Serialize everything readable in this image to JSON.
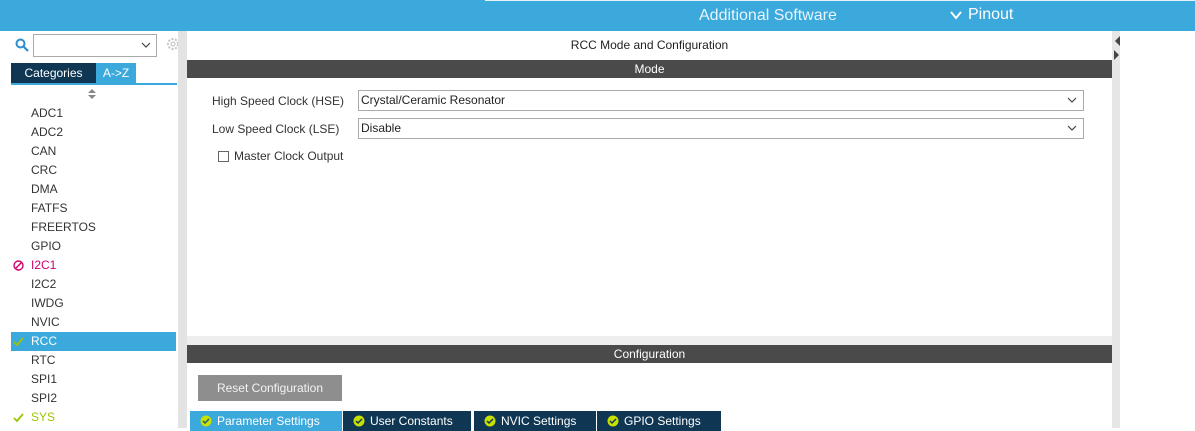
{
  "topbar": {
    "additional_software": "Additional Software",
    "pinout": "Pinout"
  },
  "sidebar": {
    "search_value": "",
    "tabs": {
      "categories": "Categories",
      "az": "A->Z"
    },
    "items": [
      {
        "label": "ADC1",
        "status": "none"
      },
      {
        "label": "ADC2",
        "status": "none"
      },
      {
        "label": "CAN",
        "status": "none"
      },
      {
        "label": "CRC",
        "status": "none"
      },
      {
        "label": "DMA",
        "status": "none"
      },
      {
        "label": "FATFS",
        "status": "none"
      },
      {
        "label": "FREERTOS",
        "status": "none"
      },
      {
        "label": "GPIO",
        "status": "none"
      },
      {
        "label": "I2C1",
        "status": "error"
      },
      {
        "label": "I2C2",
        "status": "none"
      },
      {
        "label": "IWDG",
        "status": "none"
      },
      {
        "label": "NVIC",
        "status": "none"
      },
      {
        "label": "RCC",
        "status": "ok-selected"
      },
      {
        "label": "RTC",
        "status": "none"
      },
      {
        "label": "SPI1",
        "status": "none"
      },
      {
        "label": "SPI2",
        "status": "none"
      },
      {
        "label": "SYS",
        "status": "ok"
      }
    ]
  },
  "main": {
    "title": "RCC Mode and Configuration",
    "mode_header": "Mode",
    "hse_label": "High Speed Clock (HSE)",
    "hse_value": "Crystal/Ceramic Resonator",
    "lse_label": "Low Speed Clock (LSE)",
    "lse_value": "Disable",
    "mco_label": "Master Clock Output",
    "config_header": "Configuration",
    "reset_button": "Reset Configuration",
    "config_tabs": [
      {
        "label": "Parameter Settings",
        "active": true
      },
      {
        "label": "User Constants",
        "active": false
      },
      {
        "label": "NVIC Settings",
        "active": false
      },
      {
        "label": "GPIO Settings",
        "active": false
      }
    ]
  },
  "colors": {
    "accent": "#3ba9dc",
    "dark_tab": "#0f3653",
    "error": "#d0006f",
    "ok": "#9cc500",
    "section_header": "#4a4a4a"
  }
}
